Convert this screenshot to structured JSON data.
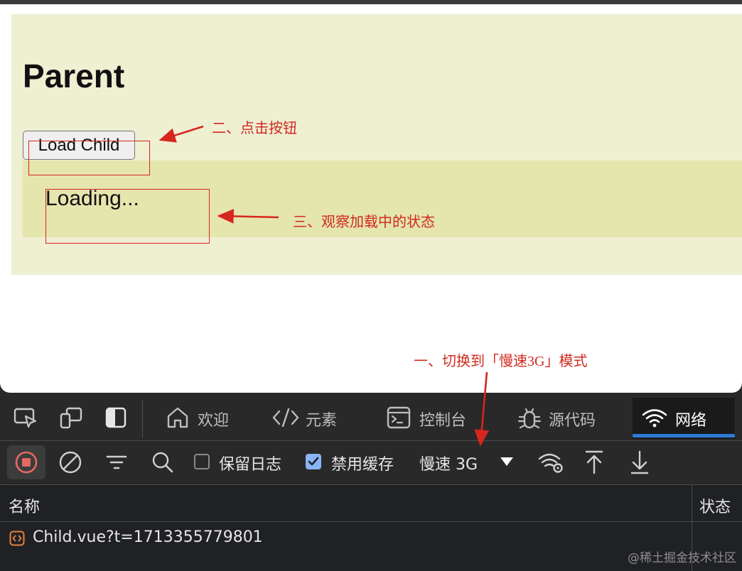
{
  "page": {
    "title": "Parent",
    "load_button": "Load Child",
    "loading_text": "Loading..."
  },
  "annotations": {
    "step1": "一、切换到「慢速3G」模式",
    "step2": "二、点击按钮",
    "step3": "三、观察加载中的状态"
  },
  "devtools": {
    "tabs": [
      {
        "icon": "home-icon",
        "label": "欢迎"
      },
      {
        "icon": "code-tag-icon",
        "label": "元素"
      },
      {
        "icon": "console-icon",
        "label": "控制台"
      },
      {
        "icon": "bug-icon",
        "label": "源代码"
      },
      {
        "icon": "wifi-icon",
        "label": "网络",
        "active": true
      }
    ],
    "toolbar": {
      "preserve_log": "保留日志",
      "disable_cache": "禁用缓存",
      "disable_cache_checked": true,
      "throttling": "慢速 3G"
    },
    "table": {
      "columns": [
        "名称",
        "状态"
      ],
      "rows": [
        {
          "name": "Child.vue?t=1713355779801",
          "status": ""
        }
      ]
    },
    "accent_color": "#2d7ad6"
  },
  "watermark": "@稀土掘金技术社区"
}
